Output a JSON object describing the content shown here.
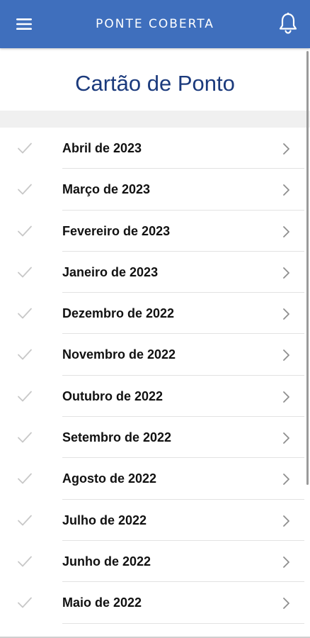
{
  "header": {
    "brand": "PONTE COBERTA",
    "menu_icon": "hamburger-menu-icon",
    "notification_icon": "bell-icon",
    "background_color": "#3f6fbd"
  },
  "page": {
    "title": "Cartão de Ponto",
    "title_color": "#1b3a7c"
  },
  "months": [
    {
      "label": "Abril de 2023"
    },
    {
      "label": "Março de 2023"
    },
    {
      "label": "Fevereiro de 2023"
    },
    {
      "label": "Janeiro de 2023"
    },
    {
      "label": "Dezembro de 2022"
    },
    {
      "label": "Novembro de 2022"
    },
    {
      "label": "Outubro de 2022"
    },
    {
      "label": "Setembro de 2022"
    },
    {
      "label": "Agosto de 2022"
    },
    {
      "label": "Julho de 2022"
    },
    {
      "label": "Junho de 2022"
    },
    {
      "label": "Maio de 2022"
    }
  ],
  "row_icons": {
    "status": "checkmark-icon",
    "navigate": "chevron-right-icon"
  }
}
